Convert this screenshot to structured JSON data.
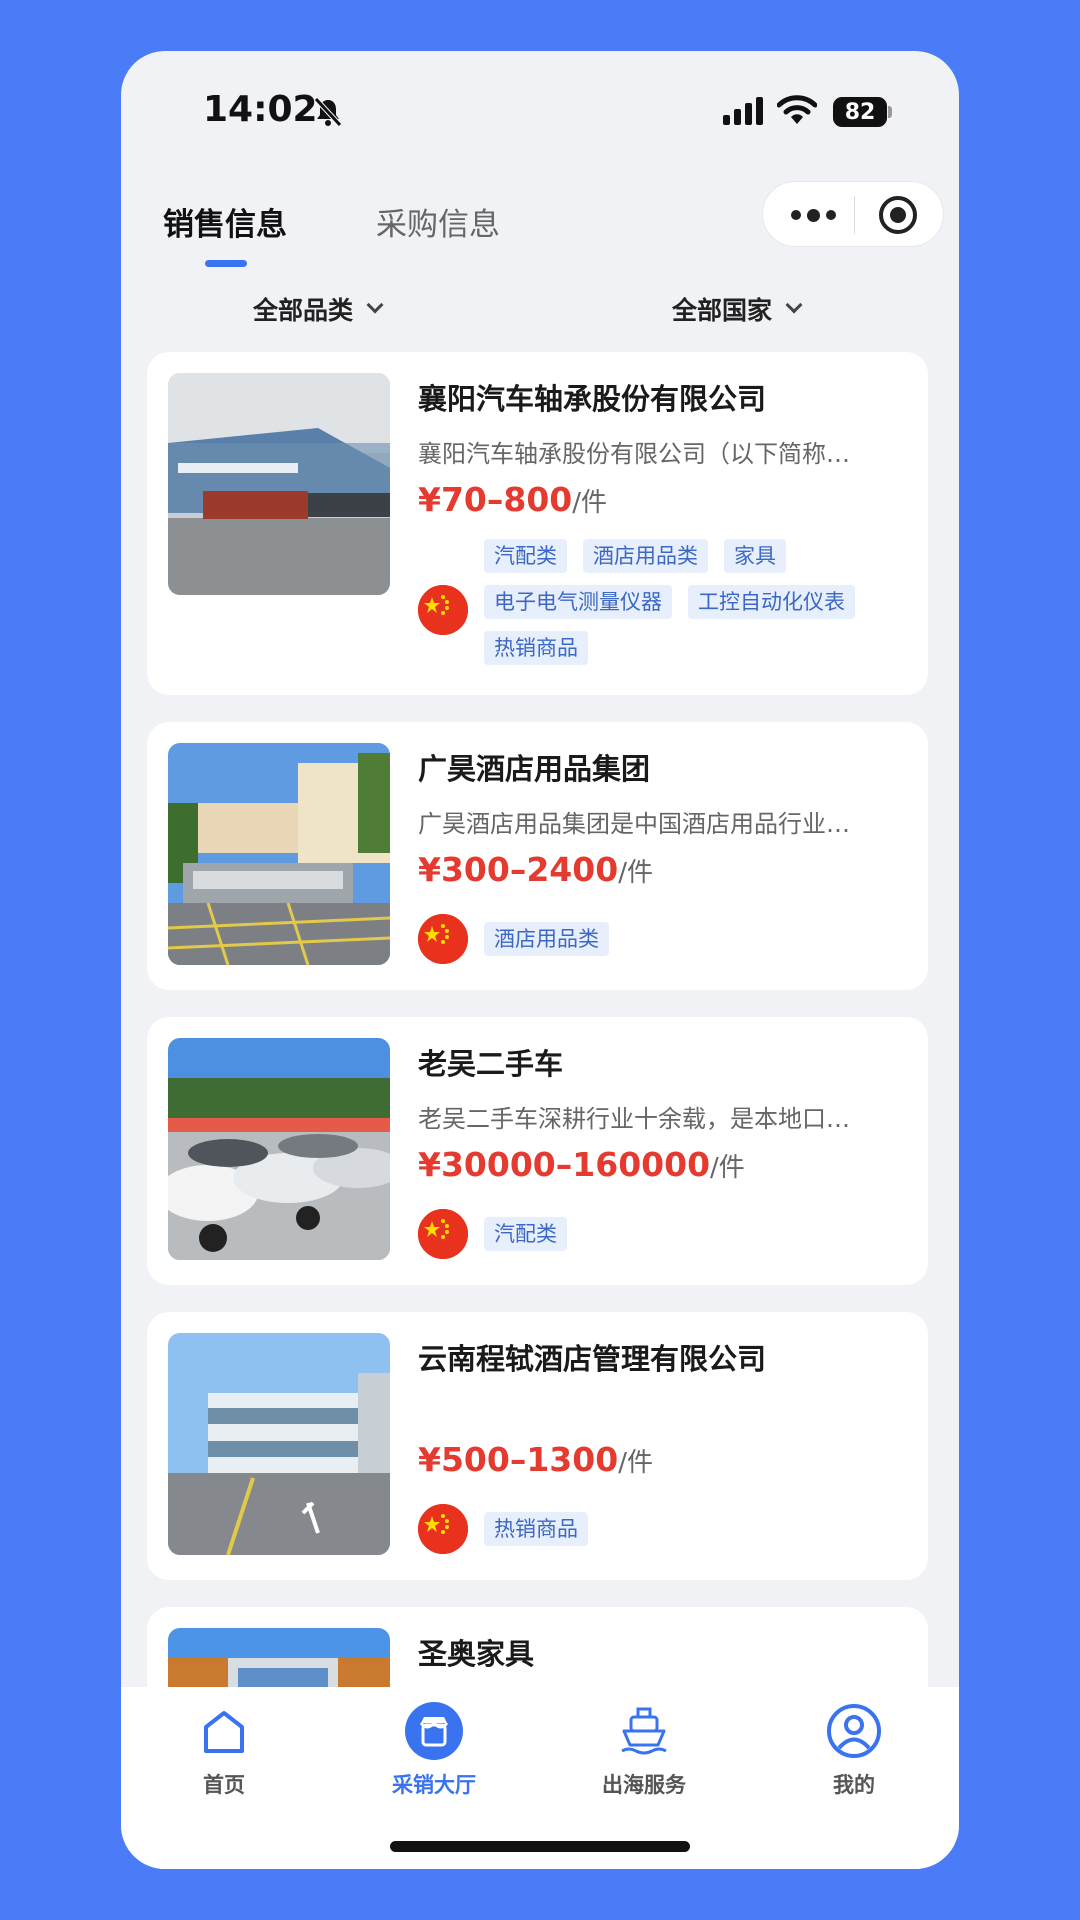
{
  "status_bar": {
    "time": "14:02",
    "battery": "82"
  },
  "tabs": [
    {
      "label": "销售信息",
      "active": true
    },
    {
      "label": "采购信息",
      "active": false
    }
  ],
  "filters": {
    "category": "全部品类",
    "country": "全部国家"
  },
  "listings": [
    {
      "title": "襄阳汽车轴承股份有限公司",
      "description": "襄阳汽车轴承股份有限公司（以下简称…",
      "price": "¥70–800",
      "unit": "/件",
      "tags": [
        "汽配类",
        "酒店用品类",
        "家具",
        "电子电气测量仪器",
        "工控自动化仪表",
        "热销商品"
      ]
    },
    {
      "title": "广昊酒店用品集团",
      "description": "广昊酒店用品集团是中国酒店用品行业…",
      "price": "¥300–2400",
      "unit": "/件",
      "tags": [
        "酒店用品类"
      ]
    },
    {
      "title": "老吴二手车",
      "description": "老吴二手车深耕行业十余载，是本地口…",
      "price": "¥30000–160000",
      "unit": "/件",
      "tags": [
        "汽配类"
      ]
    },
    {
      "title": "云南程轼酒店管理有限公司",
      "description": "",
      "price": "¥500–1300",
      "unit": "/件",
      "tags": [
        "热销商品"
      ]
    },
    {
      "title": "圣奥家具",
      "description": "",
      "price": "",
      "unit": "",
      "tags": []
    }
  ],
  "bottom_nav": [
    {
      "label": "首页",
      "icon": "home-icon",
      "active": false
    },
    {
      "label": "采销大厅",
      "icon": "store-icon",
      "active": true
    },
    {
      "label": "出海服务",
      "icon": "ship-icon",
      "active": false
    },
    {
      "label": "我的",
      "icon": "profile-icon",
      "active": false
    }
  ],
  "colors": {
    "accent": "#3a73f0",
    "price": "#e53a2f",
    "tag_bg": "#e7effd",
    "tag_text": "#3c68c4",
    "background": "#4a7cf7"
  }
}
